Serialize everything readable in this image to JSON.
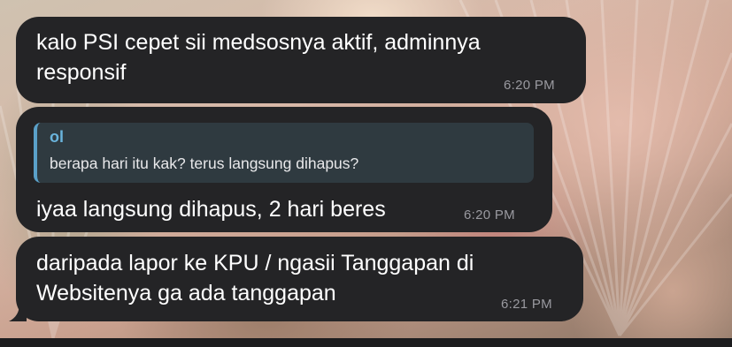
{
  "messages": [
    {
      "text": "kalo PSI cepet sii medsosnya aktif, adminnya\nresponsif",
      "time": "6:20 PM"
    },
    {
      "reply": {
        "name": "ol",
        "text": "berapa hari itu kak? terus langsung dihapus?"
      },
      "text": "iyaa langsung dihapus, 2 hari beres",
      "time": "6:20 PM"
    },
    {
      "text": "daripada lapor ke KPU / ngasii Tanggapan di\nWebsitenya ga ada tanggapan",
      "time": "6:21 PM"
    }
  ],
  "colors": {
    "bubble": "#242426",
    "quote_accent": "#5aa0c8",
    "quote_name": "#6ab4dc",
    "timestamp": "#9a9aa0"
  },
  "icons": [
    "message-tail-icon"
  ]
}
